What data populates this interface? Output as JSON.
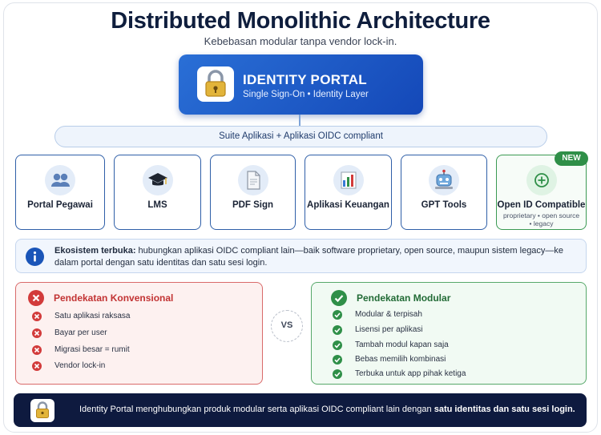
{
  "header": {
    "title": "Distributed Monolithic Architecture",
    "subtitle": "Kebebasan modular tanpa vendor lock-in."
  },
  "portal": {
    "title": "IDENTITY PORTAL",
    "subtitle": "Single Sign-On • Identity Layer",
    "icon": "padlock-icon"
  },
  "suite": {
    "label": "Suite Aplikasi + Aplikasi OIDC compliant"
  },
  "apps": [
    {
      "label": "Portal Pegawai",
      "icon": "people-icon"
    },
    {
      "label": "LMS",
      "icon": "graduation-cap-icon"
    },
    {
      "label": "PDF Sign",
      "icon": "document-icon"
    },
    {
      "label": "Aplikasi Keuangan",
      "icon": "bar-chart-icon"
    },
    {
      "label": "GPT Tools",
      "icon": "robot-icon"
    },
    {
      "label": "Open ID Compatible",
      "sub": "proprietary • open source • legacy",
      "icon": "plus-circle-icon",
      "badge": "NEW"
    }
  ],
  "info": {
    "bold": "Ekosistem terbuka:",
    "text": " hubungkan aplikasi OIDC compliant lain—baik software proprietary, open source, maupun sistem legacy—ke dalam portal dengan satu identitas dan satu sesi login."
  },
  "conventional": {
    "title": "Pendekatan Konvensional",
    "items": [
      "Satu aplikasi raksasa",
      "Bayar per user",
      "Migrasi besar = rumit",
      "Vendor lock-in"
    ]
  },
  "vs": "VS",
  "modular": {
    "title": "Pendekatan Modular",
    "items": [
      "Modular & terpisah",
      "Lisensi per aplikasi",
      "Tambah modul kapan saja",
      "Bebas memilih kombinasi",
      "Terbuka untuk app pihak ketiga"
    ]
  },
  "footer": {
    "text": "Identity Portal menghubungkan produk modular serta aplikasi OIDC compliant lain dengan ",
    "bold": "satu identitas dan satu sesi login."
  },
  "colors": {
    "portal_blue": "#1a55c4",
    "navy": "#0e1a3f",
    "red": "#d23b3b",
    "green": "#2f8f48"
  }
}
